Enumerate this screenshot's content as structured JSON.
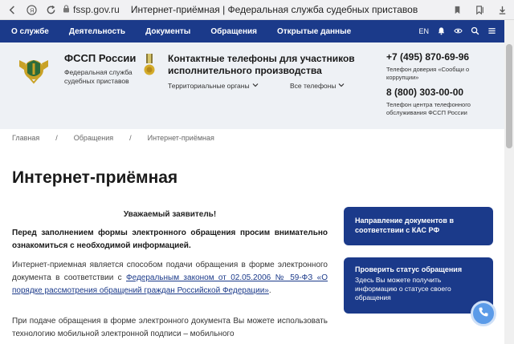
{
  "browser": {
    "url_domain": "fssp.gov.ru",
    "page_title": "Интернет-приёмная | Федеральная служба судебных приставов"
  },
  "topnav": {
    "items": [
      "О службе",
      "Деятельность",
      "Документы",
      "Обращения",
      "Открытые данные"
    ],
    "lang": "EN"
  },
  "header": {
    "org_name": "ФССП России",
    "org_sub": "Федеральная служба судебных приставов",
    "contacts_title": "Контактные телефоны для участников исполнительного производства",
    "dropdown_regions": "Территориальные органы",
    "dropdown_phones": "Все телефоны",
    "phone1": "+7 (495) 870-69-96",
    "phone1_note": "Телефон доверия «Сообщи о коррупции»",
    "phone2": "8 (800) 303-00-00",
    "phone2_note": "Телефон центра телефонного обслуживания ФССП России"
  },
  "breadcrumb": {
    "home": "Главная",
    "sep1": "/",
    "section": "Обращения",
    "sep2": "/",
    "current": "Интернет-приёмная"
  },
  "main": {
    "title": "Интернет-приёмная",
    "greeting": "Уважаемый заявитель!",
    "intro_bold": "Перед заполнением формы электронного обращения просим внимательно ознакомиться с необходимой информацией.",
    "p2_start": "Интернет-приемная является способом подачи обращения в форме электронного документа в соответствии с ",
    "p2_link": "Федеральным законом от 02.05.2006 № 59-ФЗ «О порядке рассмотрения обращений граждан Российской Федерации»",
    "p2_end": ".",
    "p3": "При подаче обращения в форме электронного документа Вы можете использовать технологию мобильной электронной подписи – мобильного"
  },
  "sidebar": {
    "card1_title": "Направление документов в соответствии с КАС РФ",
    "card2_title": "Проверить статус обращения",
    "card2_text": "Здесь Вы можете получить информацию о статусе своего обращения"
  },
  "colors": {
    "nav_bg": "#1b3a8a",
    "header_bg": "#eef1f5",
    "card_bg": "#1b3a8a",
    "fab": "#5b9be8"
  }
}
